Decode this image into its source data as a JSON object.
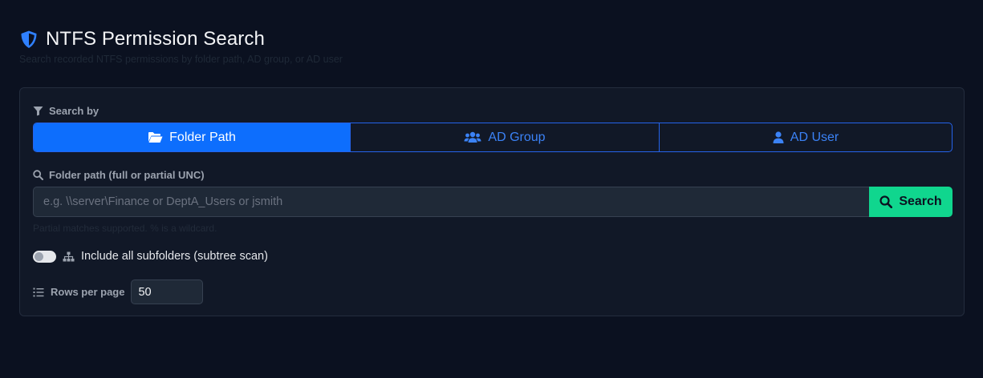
{
  "header": {
    "title": "NTFS Permission Search",
    "subtitle": "Search recorded NTFS permissions by folder path, AD group, or AD user",
    "icon": "shield-icon"
  },
  "search_by": {
    "label": "Search by",
    "icon": "filter-icon",
    "options": [
      {
        "label": "Folder Path",
        "icon": "folder-open-icon",
        "active": true
      },
      {
        "label": "AD Group",
        "icon": "users-icon",
        "active": false
      },
      {
        "label": "AD User",
        "icon": "user-icon",
        "active": false
      }
    ]
  },
  "path_field": {
    "label": "Folder path (full or partial UNC)",
    "icon": "search-icon",
    "value": "",
    "placeholder": "e.g. \\\\server\\Finance or DeptA_Users or jsmith",
    "help": "Partial matches supported. % is a wildcard."
  },
  "search_button": {
    "label": "Search",
    "icon": "search-icon"
  },
  "subfolders": {
    "label": "Include all subfolders (subtree scan)",
    "checked": false,
    "icon": "sitemap-icon"
  },
  "rows_per_page": {
    "label": "Rows per page",
    "value": "50",
    "icon": "list-ol-icon"
  },
  "colors": {
    "background": "#0b1120",
    "card": "#111827",
    "accent": "#0d6efd",
    "success": "#10d68e"
  }
}
